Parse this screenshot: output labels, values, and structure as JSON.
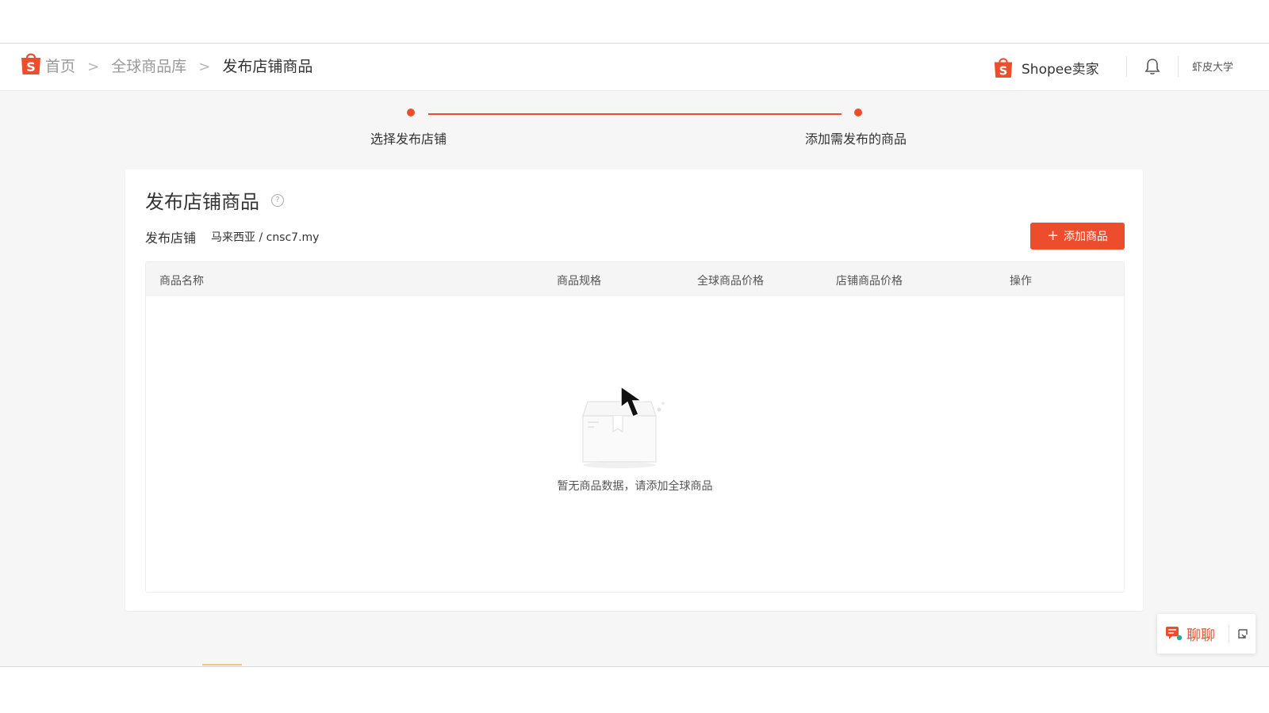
{
  "breadcrumb": {
    "items": [
      {
        "label": "首页"
      },
      {
        "label": "全球商品库"
      },
      {
        "label": "发布店铺商品"
      }
    ],
    "separator": ">"
  },
  "header": {
    "seller_name": "Shopee卖家",
    "university": "虾皮大学"
  },
  "steps": [
    {
      "label": "选择发布店铺"
    },
    {
      "label": "添加需发布的商品"
    }
  ],
  "card": {
    "title": "发布店铺商品",
    "help_icon": "?",
    "shop_label": "发布店铺",
    "shop_value": "马来西亚 / cnsc7.my",
    "add_button_icon": "+",
    "add_button": "添加商品"
  },
  "table": {
    "columns": [
      "商品名称",
      "商品规格",
      "全球商品价格",
      "店铺商品价格",
      "操作"
    ],
    "rows": [],
    "empty_text": "暂无商品数据，请添加全球商品"
  },
  "chat": {
    "label": "聊聊"
  },
  "icons": {
    "logo": "shopee-bag-icon",
    "bell": "bell-icon",
    "help": "question-circle-icon",
    "chat": "chat-icon",
    "expand": "expand-icon"
  },
  "colors": {
    "brand": "#ee4d2d",
    "background": "#f6f6f6"
  }
}
